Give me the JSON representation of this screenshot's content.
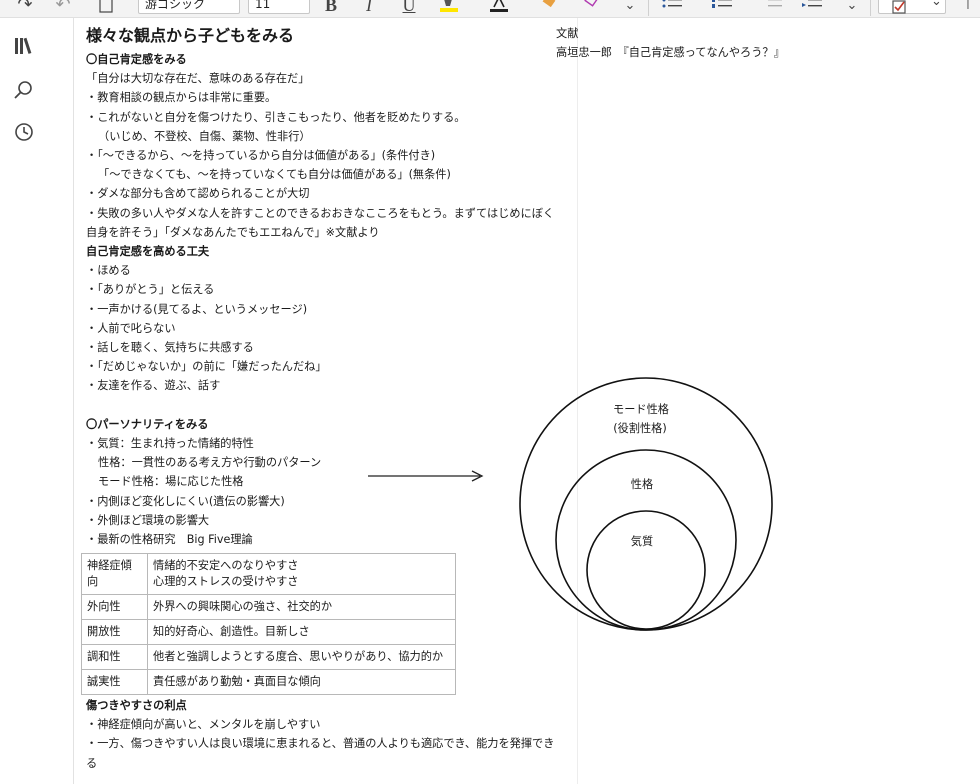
{
  "toolbar": {
    "font_name": "游ゴシック",
    "font_size": "11"
  },
  "note": {
    "title": "様々な観点から子どもをみる",
    "sec1_heading": "〇自己肯定感をみる",
    "sec1_lines": [
      "「自分は大切な存在だ、意味のある存在だ」",
      "・教育相談の観点からは非常に重要。",
      "・これがないと自分を傷つけたり、引きこもったり、他者を貶めたりする。",
      "（いじめ、不登校、自傷、薬物、性非行）",
      "・「～できるから、～を持っているから自分は価値がある」(条件付き)",
      "「～できなくても、～を持っていなくても自分は価値がある」(無条件)",
      "・ダメな部分も含めて認められることが大切",
      "・失敗の多い人やダメな人を許すことのできるおおきなこころをもとう。まずてはじめにぼく",
      "自身を許そう」「ダメなあんたでもエエねんで」※文献より"
    ],
    "sec2_heading": "自己肯定感を高める工夫",
    "sec2_lines": [
      "・ほめる",
      "・「ありがとう」と伝える",
      "・一声かける(見てるよ、というメッセージ)",
      "・人前で叱らない",
      "・話しを聴く、気持ちに共感する",
      "・「だめじゃないか」の前に「嫌だったんだね」",
      "・友達を作る、遊ぶ、話す"
    ],
    "sec3_heading": "〇パーソナリティをみる",
    "sec3_lines": [
      "・気質：生まれ持った情緒的特性",
      "性格：一貫性のある考え方や行動のパターン",
      "モード性格：場に応じた性格",
      "・内側ほど変化しにくい(遺伝の影響大)",
      "・外側ほど環境の影響大",
      "・最新の性格研究　Big Five理論"
    ],
    "table": [
      {
        "trait": "神経症傾向",
        "desc": [
          "情緒的不安定へのなりやすさ",
          "心理的ストレスの受けやすさ"
        ]
      },
      {
        "trait": "外向性",
        "desc": [
          "外界への興味関心の強さ、社交的か"
        ]
      },
      {
        "trait": "開放性",
        "desc": [
          "知的好奇心、創造性。目新しさ"
        ]
      },
      {
        "trait": "調和性",
        "desc": [
          "他者と強調しようとする度合、思いやりがあり、協力的か"
        ]
      },
      {
        "trait": "誠実性",
        "desc": [
          "責任感があり勤勉・真面目な傾向"
        ]
      }
    ],
    "sec4_heading": "傷つきやすさの利点",
    "sec4_lines": [
      "・神経症傾向が高いと、メンタルを崩しやすい",
      "・一方、傷つきやすい人は良い環境に恵まれると、普通の人よりも適応でき、能力を発揮でき",
      "る"
    ]
  },
  "refs": {
    "label": "文献",
    "entry": "高垣忠一郎　『自己肯定感ってなんやろう？』"
  },
  "diagram": {
    "outer_label_1": "モード性格",
    "outer_label_2": "(役割性格)",
    "middle_label": "性格",
    "inner_label": "気質"
  }
}
